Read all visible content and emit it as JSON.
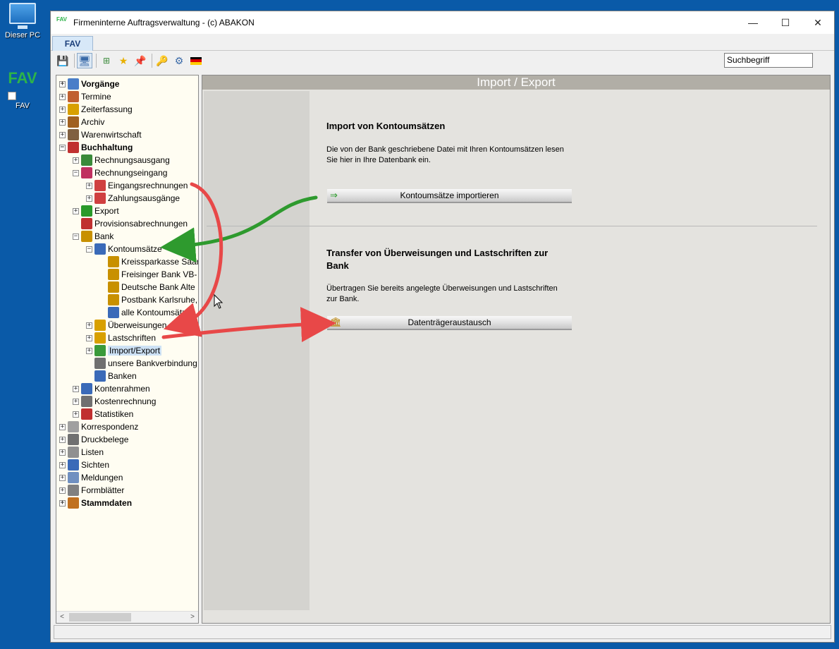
{
  "desktop": {
    "icons": [
      {
        "label": "Dieser PC",
        "icon": "computer-icon"
      },
      {
        "label": "FAV",
        "icon": "fav-app-icon",
        "logo_text": "FAV"
      }
    ]
  },
  "window": {
    "title": "Firmeninterne Auftragsverwaltung - (c) ABAKON",
    "app_icon_text": "FAV",
    "controls": {
      "minimize": "—",
      "maximize": "☐",
      "close": "✕"
    }
  },
  "tab": {
    "label": "FAV"
  },
  "toolbar": {
    "icons": [
      "save-icon",
      "monitor-icon",
      "tree-icon",
      "star-icon",
      "pin-icon",
      "key-icon",
      "network-icon",
      "german-flag-icon"
    ],
    "search_value": "Suchbegriff"
  },
  "tree": {
    "items": [
      {
        "label": "Vorgänge",
        "bold": true,
        "expander": "+"
      },
      {
        "label": "Termine",
        "expander": "+"
      },
      {
        "label": "Zeiterfassung",
        "expander": "+"
      },
      {
        "label": "Archiv",
        "expander": "+"
      },
      {
        "label": "Warenwirtschaft",
        "expander": "+"
      },
      {
        "label": "Buchhaltung",
        "bold": true,
        "expander": "−"
      },
      {
        "label": "Rechnungsausgang",
        "expander": "+"
      },
      {
        "label": "Rechnungseingang",
        "expander": "−"
      },
      {
        "label": "Eingangsrechnungen",
        "expander": "+"
      },
      {
        "label": "Zahlungsausgänge",
        "expander": "+"
      },
      {
        "label": "Export",
        "expander": "+"
      },
      {
        "label": "Provisionsabrechnungen",
        "expander": ""
      },
      {
        "label": "Bank",
        "expander": "−"
      },
      {
        "label": "Kontoumsätze",
        "expander": "−"
      },
      {
        "label": "Kreissparkasse Saarl",
        "expander": ""
      },
      {
        "label": "Freisinger Bank VB-",
        "expander": ""
      },
      {
        "label": "Deutsche Bank Alte",
        "expander": ""
      },
      {
        "label": "Postbank Karlsruhe,",
        "expander": ""
      },
      {
        "label": "alle Kontoumsätze",
        "expander": ""
      },
      {
        "label": "Überweisungen",
        "expander": "+"
      },
      {
        "label": "Lastschriften",
        "expander": "+"
      },
      {
        "label": "Import/Export",
        "expander": "+",
        "selected": true
      },
      {
        "label": "unsere Bankverbindung",
        "expander": ""
      },
      {
        "label": "Banken",
        "expander": ""
      },
      {
        "label": "Kontenrahmen",
        "expander": "+"
      },
      {
        "label": "Kostenrechnung",
        "expander": "+"
      },
      {
        "label": "Statistiken",
        "expander": "+"
      },
      {
        "label": "Korrespondenz",
        "expander": "+"
      },
      {
        "label": "Druckbelege",
        "expander": "+"
      },
      {
        "label": "Listen",
        "expander": "+"
      },
      {
        "label": "Sichten",
        "expander": "+"
      },
      {
        "label": "Meldungen",
        "expander": "+"
      },
      {
        "label": "Formblätter",
        "expander": "+"
      },
      {
        "label": "Stammdaten",
        "bold": true,
        "expander": "+"
      }
    ],
    "scroll_left": "<",
    "scroll_right": ">"
  },
  "content": {
    "header": "Import / Export",
    "section1": {
      "title": "Import von Kontoumsätzen",
      "text": "Die von der Bank geschriebene Datei mit Ihren Kontoumsätzen lesen Sie hier in Ihre Datenbank ein.",
      "button_label": "Kontoumsätze importieren",
      "button_icon": "⇒"
    },
    "section2": {
      "title": "Transfer von Überweisungen und Lastschriften zur Bank",
      "text": "Übertragen Sie bereits angelegte Überweisungen und Lastschriften zur Bank.",
      "button_label": "Datenträgeraustausch",
      "button_icon": "🏛"
    }
  },
  "colors": {
    "desktop": "#0a5aa8",
    "content_header": "#b1aea6",
    "tree_bg": "#fffdf2",
    "arrow_green": "#2e9a2e",
    "arrow_red": "#e84848"
  }
}
